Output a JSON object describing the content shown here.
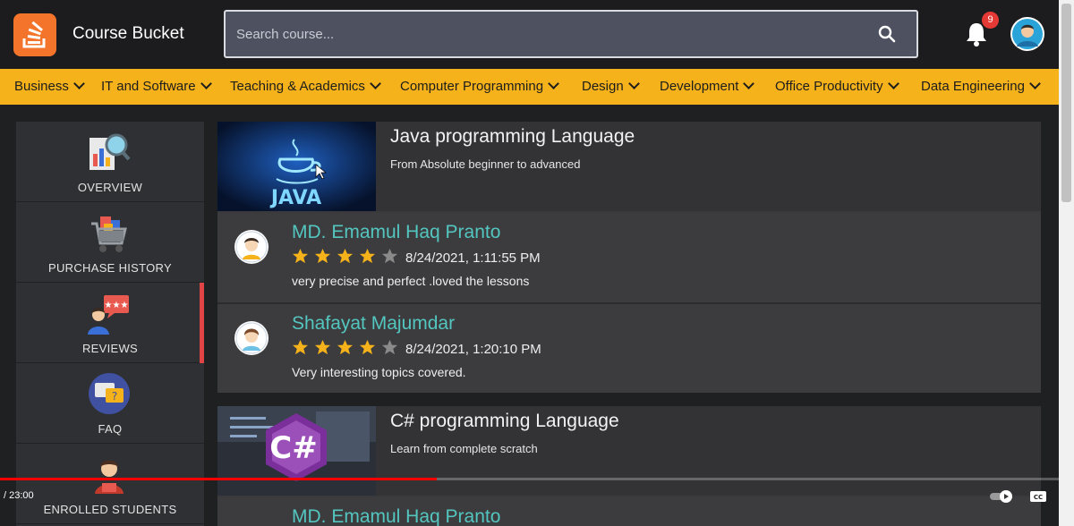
{
  "header": {
    "brand": "Course Bucket",
    "search_placeholder": "Search course...",
    "notification_count": "9",
    "icons": {
      "logo": "stack-logo-icon",
      "search": "search-icon",
      "bell": "bell-icon",
      "avatar": "user-avatar-icon"
    }
  },
  "categories": [
    "Business",
    "IT and Software",
    "Teaching & Academics",
    "Computer Programming",
    "Design",
    "Development",
    "Office Productivity",
    "Data Engineering"
  ],
  "sidebar": {
    "items": [
      {
        "label": "OVERVIEW",
        "icon": "overview-chart-icon"
      },
      {
        "label": "PURCHASE HISTORY",
        "icon": "shopping-cart-icon"
      },
      {
        "label": "REVIEWS",
        "icon": "reviews-chat-icon",
        "active": true
      },
      {
        "label": "FAQ",
        "icon": "faq-chat-icon"
      },
      {
        "label": "ENROLLED STUDENTS",
        "icon": "student-icon"
      }
    ]
  },
  "courses": [
    {
      "title": "Java programming Language",
      "subtitle": "From Absolute beginner to advanced",
      "thumb_label": "JAVA",
      "reviews": [
        {
          "name": "MD. Emamul Haq Pranto",
          "rating": 4,
          "max": 5,
          "date": "8/24/2021, 1:11:55 PM",
          "text": "very precise and perfect .loved the lessons"
        },
        {
          "name": "Shafayat Majumdar",
          "rating": 4,
          "max": 5,
          "date": "8/24/2021, 1:20:10 PM",
          "text": "Very interesting topics covered."
        }
      ]
    },
    {
      "title": "C# programming Language",
      "subtitle": "Learn from complete scratch",
      "thumb_label": "C#",
      "reviews": [
        {
          "name": "MD. Emamul Haq Pranto"
        }
      ]
    }
  ],
  "video": {
    "time": "/ 23:00",
    "progress": 0.41,
    "colors": {
      "progress": "#ff0000",
      "accent": "#f5b21a",
      "name": "#53c6c0"
    }
  }
}
